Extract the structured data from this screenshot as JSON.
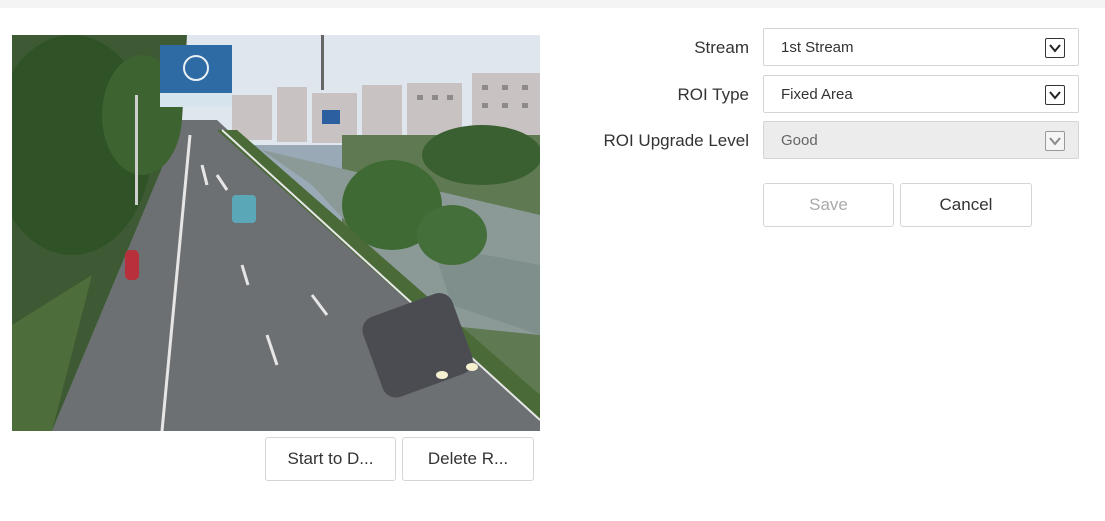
{
  "video": {
    "buttons": {
      "start_label": "Start to D...",
      "delete_label": "Delete R..."
    }
  },
  "form": {
    "stream": {
      "label": "Stream",
      "value": "1st Stream"
    },
    "roi_type": {
      "label": "ROI Type",
      "value": "Fixed Area"
    },
    "roi_level": {
      "label": "ROI Upgrade Level",
      "value": "Good",
      "disabled": true
    },
    "save_label": "Save",
    "cancel_label": "Cancel"
  },
  "icons": {
    "select_caret": "chevron-down-icon"
  }
}
